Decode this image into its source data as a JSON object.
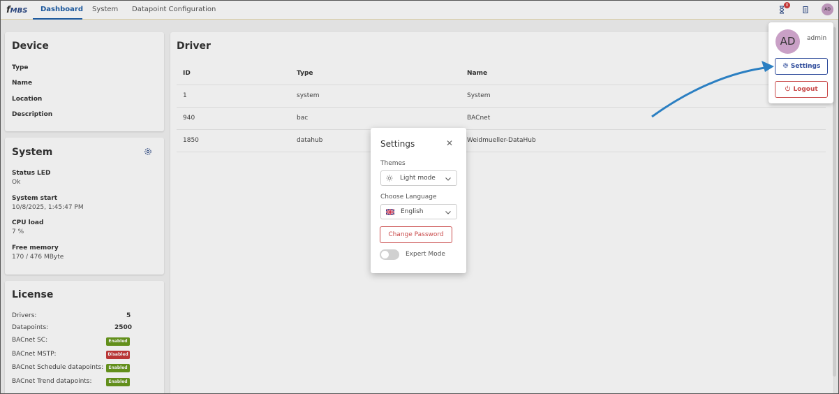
{
  "nav": {
    "logo": "MBS",
    "tabs": [
      "Dashboard",
      "System",
      "Datapoint Configuration"
    ],
    "notification_count": "0",
    "avatar_initials": "AD"
  },
  "device": {
    "title": "Device",
    "fields": [
      "Type",
      "Name",
      "Location",
      "Description"
    ]
  },
  "system": {
    "title": "System",
    "items": [
      {
        "label": "Status LED",
        "value": "Ok"
      },
      {
        "label": "System start",
        "value": "10/8/2025, 1:45:47 PM"
      },
      {
        "label": "CPU load",
        "value": "7 %"
      },
      {
        "label": "Free memory",
        "value": "170 / 476 MByte"
      }
    ]
  },
  "license": {
    "title": "License",
    "rows": [
      {
        "label": "Drivers:",
        "value": "5"
      },
      {
        "label": "Datapoints:",
        "value": "2500"
      },
      {
        "label": "BACnet SC:",
        "status": "Enabled"
      },
      {
        "label": "BACnet MSTP:",
        "status": "Disabled"
      },
      {
        "label": "BACnet Schedule datapoints:",
        "status": "Enabled"
      },
      {
        "label": "BACnet Trend datapoints:",
        "status": "Enabled"
      }
    ]
  },
  "driver": {
    "title": "Driver",
    "columns": [
      "ID",
      "Type",
      "Name"
    ],
    "rows": [
      [
        "1",
        "system",
        "System"
      ],
      [
        "940",
        "bac",
        "BACnet"
      ],
      [
        "1850",
        "datahub",
        "Weidmueller-DataHub"
      ]
    ]
  },
  "user_menu": {
    "initials": "AD",
    "username": "admin",
    "settings_label": "Settings",
    "logout_label": "Logout"
  },
  "settings_dialog": {
    "title": "Settings",
    "themes_label": "Themes",
    "theme_value": "Light mode",
    "language_label": "Choose Language",
    "language_value": "English",
    "change_password_label": "Change Password",
    "expert_mode_label": "Expert Mode"
  },
  "colors": {
    "primary": "#1f5fa8",
    "danger": "#c94a4a",
    "enabled": "#6a9a1e",
    "disabled": "#c73b3b",
    "avatar": "#c9a0c6"
  }
}
